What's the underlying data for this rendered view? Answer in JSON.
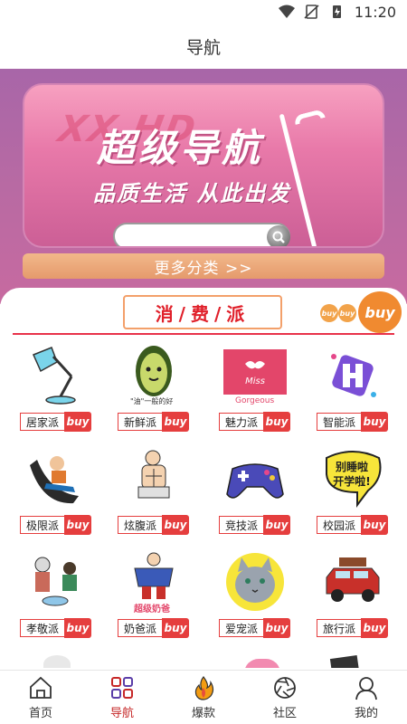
{
  "status": {
    "time": "11:20"
  },
  "header": {
    "title": "导航"
  },
  "banner": {
    "title": "超级导航",
    "slogan": "品质生活 从此出发",
    "more_label": "更多分类 >>"
  },
  "section": {
    "title": "消/费/派",
    "badge": "buy"
  },
  "categories": [
    {
      "label": "居家派",
      "buy": "buy",
      "icon": "desk-lamp-icon"
    },
    {
      "label": "新鲜派",
      "buy": "buy",
      "icon": "avocado-icon",
      "caption": "\"油\"一般的好"
    },
    {
      "label": "魅力派",
      "buy": "buy",
      "icon": "miss-gorgeous-icon",
      "caption": "Gorgeous"
    },
    {
      "label": "智能派",
      "buy": "buy",
      "icon": "smart-logo-icon"
    },
    {
      "label": "极限派",
      "buy": "buy",
      "icon": "skateboard-icon"
    },
    {
      "label": "炫腹派",
      "buy": "buy",
      "icon": "abs-man-icon"
    },
    {
      "label": "竞技派",
      "buy": "buy",
      "icon": "gamepad-icon"
    },
    {
      "label": "校园派",
      "buy": "buy",
      "icon": "speech-bubble-icon",
      "caption": "别睡啦 开学啦!"
    },
    {
      "label": "孝敬派",
      "buy": "buy",
      "icon": "elderly-care-icon"
    },
    {
      "label": "奶爸派",
      "buy": "buy",
      "icon": "super-dad-icon",
      "caption": "超级奶爸"
    },
    {
      "label": "爱宠派",
      "buy": "buy",
      "icon": "cat-icon"
    },
    {
      "label": "旅行派",
      "buy": "buy",
      "icon": "travel-car-icon"
    }
  ],
  "nav": [
    {
      "label": "首页",
      "icon": "home-icon",
      "active": false
    },
    {
      "label": "导航",
      "icon": "grid-nav-icon",
      "active": true
    },
    {
      "label": "爆款",
      "icon": "flame-icon",
      "active": false
    },
    {
      "label": "社区",
      "icon": "aperture-icon",
      "active": false
    },
    {
      "label": "我的",
      "icon": "user-icon",
      "active": false
    }
  ],
  "colors": {
    "accent": "#e53e3e",
    "banner_bg": "#b86aa3",
    "nav_active": "#c62828"
  }
}
